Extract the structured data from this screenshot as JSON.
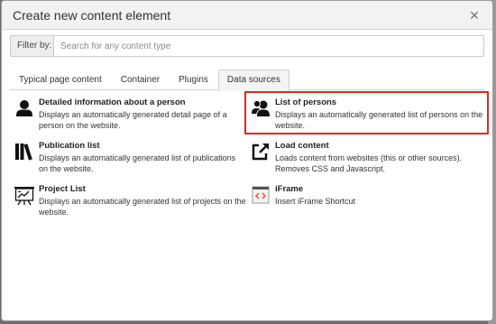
{
  "modal": {
    "title": "Create new content element",
    "close_icon": "close-icon"
  },
  "filter": {
    "label": "Filter by:",
    "placeholder": "Search for any content type",
    "value": ""
  },
  "tabs": [
    {
      "label": "Typical page content",
      "active": false
    },
    {
      "label": "Container",
      "active": false
    },
    {
      "label": "Plugins",
      "active": false
    },
    {
      "label": "Data sources",
      "active": true
    }
  ],
  "items": [
    {
      "icon": "person-icon",
      "title": "Detailed information about a person",
      "description": "Displays an automatically generated detail page of a person on the website."
    },
    {
      "icon": "persons-group-icon",
      "title": "List of persons",
      "description": "Displays an automatically generated list of persons on the website.",
      "highlighted": true
    },
    {
      "icon": "books-icon",
      "title": "Publication list",
      "description": "Displays an automatically generated list of publications on the website."
    },
    {
      "icon": "external-link-icon",
      "title": "Load content",
      "description": "Loads content from websites (this or other sources). Removes CSS and Javascript."
    },
    {
      "icon": "presentation-board-icon",
      "title": "Project List",
      "description": "Displays an automatically generated list of projects on the website."
    },
    {
      "icon": "iframe-code-icon",
      "title": "iFrame",
      "description": "Insert iFrame Shortcut"
    }
  ],
  "colors": {
    "highlight_border": "#e3261d",
    "iframe_accent": "#e8663d"
  }
}
